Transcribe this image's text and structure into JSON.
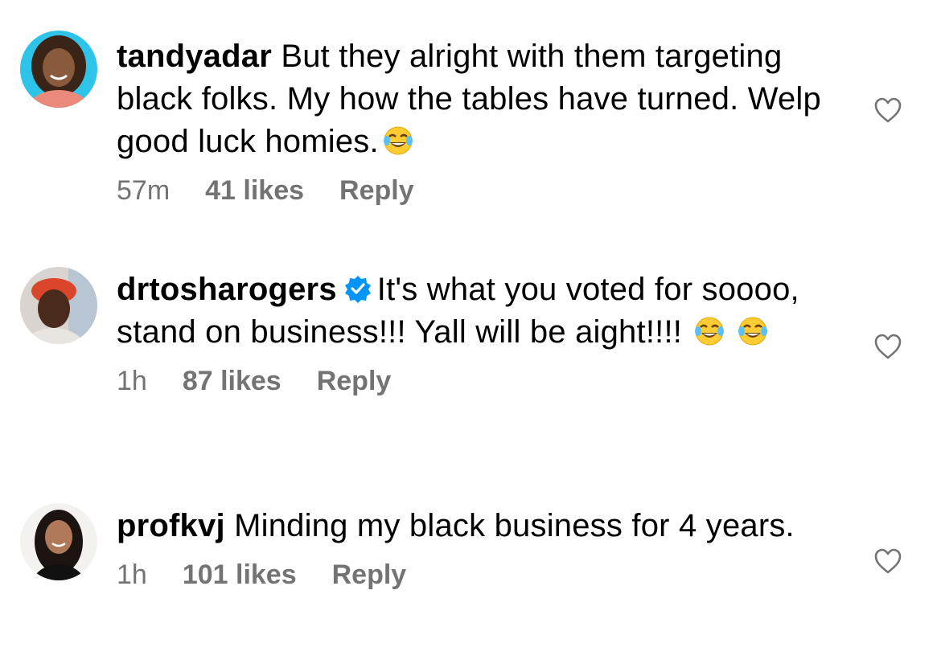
{
  "comments": [
    {
      "username": "tandyadar",
      "verified": false,
      "text_before": "But they alright with them targeting black folks. My how the tables have turned. Welp good luck homies.",
      "emoji_count": 1,
      "text_after": "",
      "time": "57m",
      "likes": "41 likes",
      "reply": "Reply",
      "avatar_icon": "profile-photo-woman-curly-hair"
    },
    {
      "username": "drtosharogers",
      "verified": true,
      "text_before": "It's what you voted for soooo, stand on business!!! Yall will be aight!!!!",
      "emoji_count": 2,
      "text_after": "",
      "time": "1h",
      "likes": "87 likes",
      "reply": "Reply",
      "avatar_icon": "profile-photo-woman-headwrap"
    },
    {
      "username": "profkvj",
      "verified": false,
      "text_before": "Minding my black business for 4 years.",
      "emoji_count": 0,
      "text_after": "",
      "time": "1h",
      "likes": "101 likes",
      "reply": "Reply",
      "avatar_icon": "profile-photo-woman-dark-hair"
    }
  ],
  "colors": {
    "meta_gray": "#737373",
    "verified_blue": "#0095f6",
    "heart_stroke": "#737373"
  },
  "icons": {
    "like": "heart-outline-icon",
    "verified": "verified-badge-icon",
    "emoji": "face-with-tears-of-joy-emoji"
  }
}
